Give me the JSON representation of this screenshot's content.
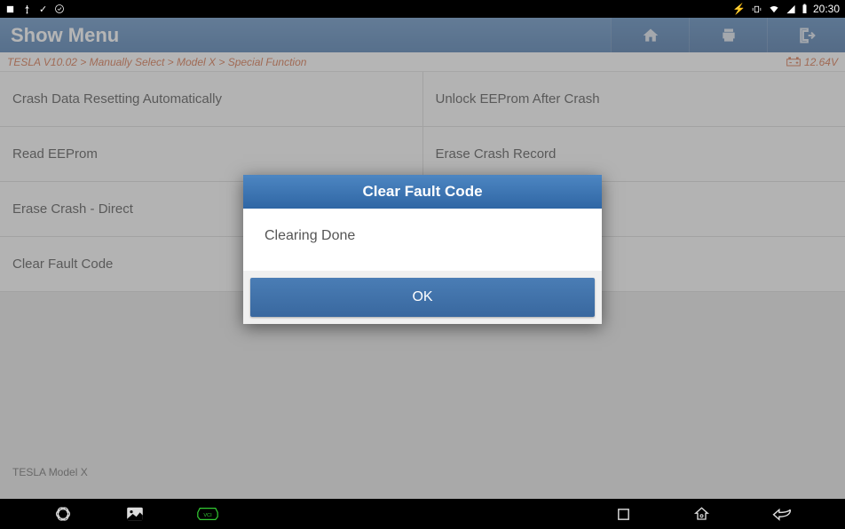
{
  "status": {
    "time": "20:30"
  },
  "titlebar": {
    "title": "Show Menu"
  },
  "breadcrumb": {
    "path": "TESLA V10.02 > Manually Select > Model X > Special Function",
    "voltage": "12.64V"
  },
  "menu": {
    "rows": [
      {
        "left": "Crash Data Resetting Automatically",
        "right": "Unlock EEProm After Crash"
      },
      {
        "left": "Read EEProm",
        "right": "Erase Crash Record"
      },
      {
        "left": "Erase Crash - Direct",
        "right": ""
      },
      {
        "left": "Clear Fault Code",
        "right": ""
      }
    ]
  },
  "footer": {
    "info": "TESLA Model X"
  },
  "dialog": {
    "title": "Clear Fault Code",
    "message": "Clearing Done",
    "ok": "OK"
  }
}
